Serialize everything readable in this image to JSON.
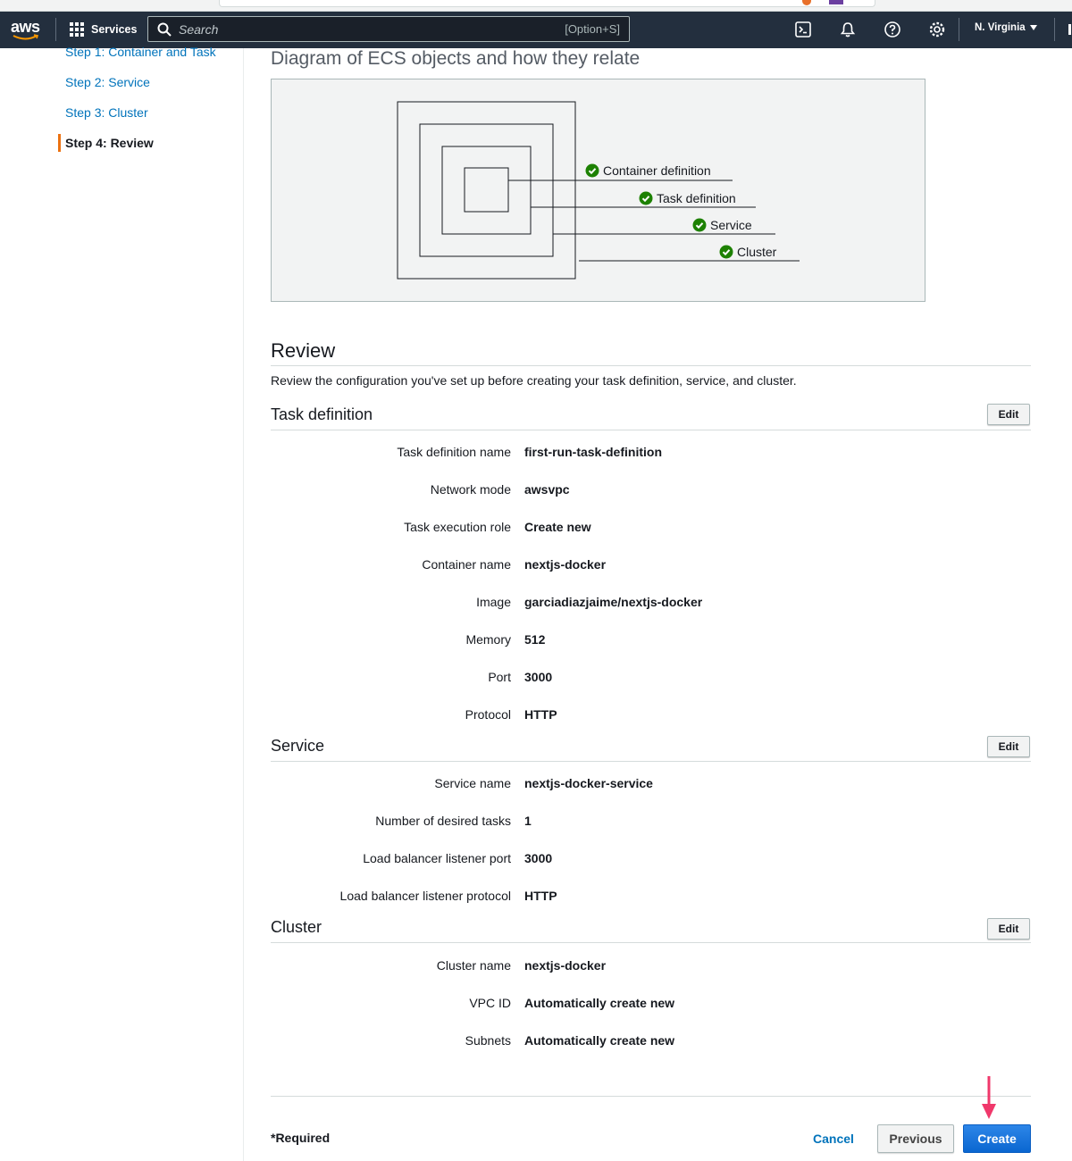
{
  "header": {
    "logo_text": "aws",
    "services_label": "Services",
    "search_placeholder": "Search",
    "search_shortcut": "[Option+S]",
    "region": "N. Virginia"
  },
  "sidebar": {
    "steps": [
      {
        "label": "Step 1: Container and Task"
      },
      {
        "label": "Step 2: Service"
      },
      {
        "label": "Step 3: Cluster"
      },
      {
        "label": "Step 4: Review"
      }
    ]
  },
  "diagram": {
    "title": "Diagram of ECS objects and how they relate",
    "labels": [
      "Container definition",
      "Task definition",
      "Service",
      "Cluster"
    ]
  },
  "review": {
    "title": "Review",
    "description": "Review the configuration you've set up before creating your task definition, service, and cluster.",
    "edit_label": "Edit",
    "sections": [
      {
        "title": "Task definition",
        "rows": [
          {
            "key": "Task definition name",
            "value": "first-run-task-definition"
          },
          {
            "key": "Network mode",
            "value": "awsvpc"
          },
          {
            "key": "Task execution role",
            "value": "Create new"
          },
          {
            "key": "Container name",
            "value": "nextjs-docker"
          },
          {
            "key": "Image",
            "value": "garciadiazjaime/nextjs-docker"
          },
          {
            "key": "Memory",
            "value": "512"
          },
          {
            "key": "Port",
            "value": "3000"
          },
          {
            "key": "Protocol",
            "value": "HTTP"
          }
        ]
      },
      {
        "title": "Service",
        "rows": [
          {
            "key": "Service name",
            "value": "nextjs-docker-service"
          },
          {
            "key": "Number of desired tasks",
            "value": "1"
          },
          {
            "key": "Load balancer listener port",
            "value": "3000"
          },
          {
            "key": "Load balancer listener protocol",
            "value": "HTTP"
          }
        ]
      },
      {
        "title": "Cluster",
        "rows": [
          {
            "key": "Cluster name",
            "value": "nextjs-docker"
          },
          {
            "key": "VPC ID",
            "value": "Automatically create new"
          },
          {
            "key": "Subnets",
            "value": "Automatically create new"
          }
        ]
      }
    ]
  },
  "footer": {
    "required": "*Required",
    "cancel": "Cancel",
    "previous": "Previous",
    "create": "Create"
  },
  "colors": {
    "nav_bg": "#232f3e",
    "link": "#0073bb",
    "active_step_bar": "#ec7211",
    "check_green": "#1d8102",
    "primary_button": "#0a66d0",
    "annotation_arrow": "#f0386b"
  }
}
